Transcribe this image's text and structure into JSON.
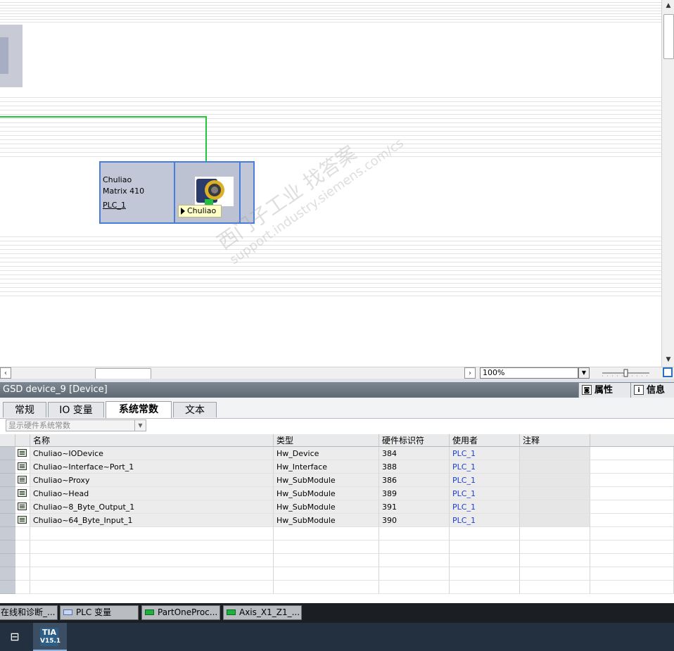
{
  "canvas": {
    "device": {
      "line1": "Chuliao",
      "line2": "Matrix 410",
      "plc_link": "PLC_1",
      "tooltip": "Chuliao"
    },
    "connection_color": "#1ec83a",
    "device_border_color": "#4a7ddb",
    "zoom": "100%"
  },
  "inspector": {
    "title": "GSD device_9 [Device]",
    "right_tabs": [
      {
        "label": "属性",
        "icon": "properties-icon"
      },
      {
        "label": "信息",
        "icon": "info-icon"
      }
    ],
    "tabs": [
      "常规",
      "IO 变量",
      "系统常数",
      "文本"
    ],
    "active_tab": "系统常数",
    "filter": "显示硬件系统常数",
    "table": {
      "headers": [
        "名称",
        "类型",
        "硬件标识符",
        "使用者",
        "注释"
      ],
      "rows": [
        {
          "name": "Chuliao~IODevice",
          "type": "Hw_Device",
          "hwid": "384",
          "user": "PLC_1",
          "comment": ""
        },
        {
          "name": "Chuliao~Interface~Port_1",
          "type": "Hw_Interface",
          "hwid": "388",
          "user": "PLC_1",
          "comment": ""
        },
        {
          "name": "Chuliao~Proxy",
          "type": "Hw_SubModule",
          "hwid": "386",
          "user": "PLC_1",
          "comment": ""
        },
        {
          "name": "Chuliao~Head",
          "type": "Hw_SubModule",
          "hwid": "389",
          "user": "PLC_1",
          "comment": ""
        },
        {
          "name": "Chuliao~8_Byte_Output_1",
          "type": "Hw_SubModule",
          "hwid": "391",
          "user": "PLC_1",
          "comment": ""
        },
        {
          "name": "Chuliao~64_Byte_Input_1",
          "type": "Hw_SubModule",
          "hwid": "390",
          "user": "PLC_1",
          "comment": ""
        }
      ]
    }
  },
  "editor_tabs": [
    {
      "label": "在线和诊断_...",
      "icon": "online-icon"
    },
    {
      "label": "PLC 变量",
      "icon": "tag-table-icon"
    },
    {
      "label": "PartOneProc...",
      "icon": "block-icon"
    },
    {
      "label": "Axis_X1_Z1_...",
      "icon": "block-icon"
    }
  ],
  "taskbar": {
    "app_logo_line1": "TIA",
    "app_logo_line2": "V15.1"
  },
  "watermark": {
    "line1": "西门子工业  找答案",
    "line2": "support.industry.siemens.com/cs"
  }
}
